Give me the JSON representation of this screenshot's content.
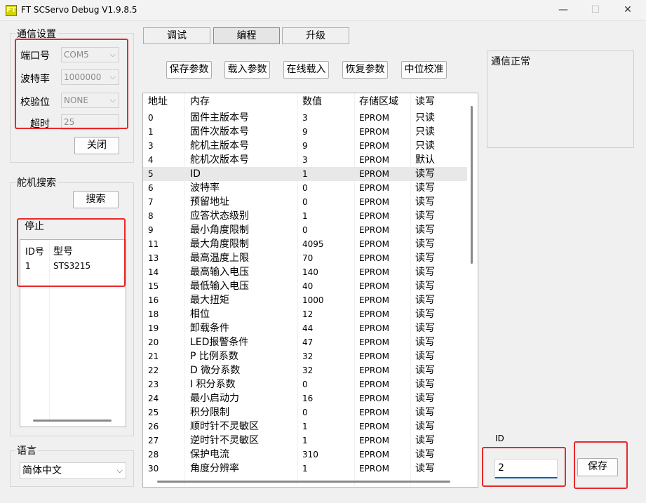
{
  "window": {
    "title": "FT SCServo Debug V1.9.8.5",
    "icon_text": "FT",
    "controls": [
      "—",
      "☐",
      "✕"
    ]
  },
  "comm": {
    "group_title": "通信设置",
    "port_label": "端口号",
    "port_value": "COM5",
    "baud_label": "波特率",
    "baud_value": "1000000",
    "parity_label": "校验位",
    "parity_value": "NONE",
    "timeout_label": "超时",
    "timeout_value": "25",
    "close_button": "关闭"
  },
  "servo_search": {
    "group_title": "舵机搜索",
    "search_button": "搜索",
    "status": "停止",
    "columns": [
      "ID号",
      "型号"
    ],
    "rows": [
      [
        "1",
        "STS3215"
      ]
    ]
  },
  "language": {
    "group_title": "语言",
    "value": "简体中文"
  },
  "tabs": [
    "调试",
    "编程",
    "升级"
  ],
  "actions": [
    "保存参数",
    "载入参数",
    "在线载入",
    "恢复参数",
    "中位校准"
  ],
  "table": {
    "columns": [
      "地址",
      "内存",
      "数值",
      "存储区域",
      "读写"
    ],
    "rows": [
      [
        "0",
        "固件主版本号",
        "3",
        "EPROM",
        "只读"
      ],
      [
        "1",
        "固件次版本号",
        "9",
        "EPROM",
        "只读"
      ],
      [
        "3",
        "舵机主版本号",
        "9",
        "EPROM",
        "只读"
      ],
      [
        "4",
        "舵机次版本号",
        "3",
        "EPROM",
        "默认"
      ],
      [
        "5",
        "ID",
        "1",
        "EPROM",
        "读写"
      ],
      [
        "6",
        "波特率",
        "0",
        "EPROM",
        "读写"
      ],
      [
        "7",
        "预留地址",
        "0",
        "EPROM",
        "读写"
      ],
      [
        "8",
        "应答状态级别",
        "1",
        "EPROM",
        "读写"
      ],
      [
        "9",
        "最小角度限制",
        "0",
        "EPROM",
        "读写"
      ],
      [
        "11",
        "最大角度限制",
        "4095",
        "EPROM",
        "读写"
      ],
      [
        "13",
        "最高温度上限",
        "70",
        "EPROM",
        "读写"
      ],
      [
        "14",
        "最高输入电压",
        "140",
        "EPROM",
        "读写"
      ],
      [
        "15",
        "最低输入电压",
        "40",
        "EPROM",
        "读写"
      ],
      [
        "16",
        "最大扭矩",
        "1000",
        "EPROM",
        "读写"
      ],
      [
        "18",
        "相位",
        "12",
        "EPROM",
        "读写"
      ],
      [
        "19",
        "卸载条件",
        "44",
        "EPROM",
        "读写"
      ],
      [
        "20",
        "LED报警条件",
        "47",
        "EPROM",
        "读写"
      ],
      [
        "21",
        "P 比例系数",
        "32",
        "EPROM",
        "读写"
      ],
      [
        "22",
        "D 微分系数",
        "32",
        "EPROM",
        "读写"
      ],
      [
        "23",
        "I 积分系数",
        "0",
        "EPROM",
        "读写"
      ],
      [
        "24",
        "最小启动力",
        "16",
        "EPROM",
        "读写"
      ],
      [
        "25",
        "积分限制",
        "0",
        "EPROM",
        "读写"
      ],
      [
        "26",
        "顺时针不灵敏区",
        "1",
        "EPROM",
        "读写"
      ],
      [
        "27",
        "逆时针不灵敏区",
        "1",
        "EPROM",
        "读写"
      ],
      [
        "28",
        "保护电流",
        "310",
        "EPROM",
        "读写"
      ],
      [
        "30",
        "角度分辨率",
        "1",
        "EPROM",
        "读写"
      ]
    ],
    "selected_row": 4
  },
  "status_text": "通信正常",
  "id_edit": {
    "label": "ID",
    "value": "2",
    "save_button": "保存"
  },
  "colors": {
    "highlight": "#e8282b",
    "window_bg": "#f0f0f0"
  }
}
